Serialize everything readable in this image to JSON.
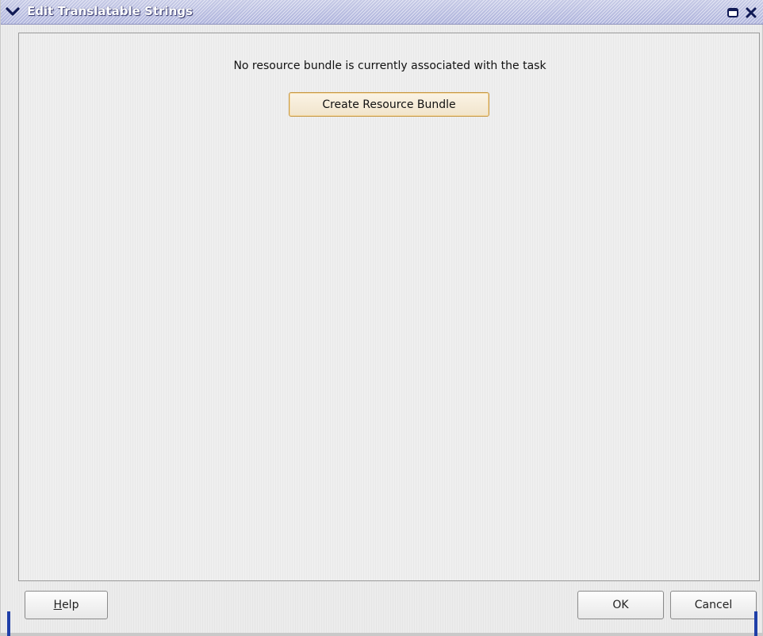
{
  "window": {
    "title": "Edit Translatable Strings",
    "controls": {
      "menu_icon": "chevron-down-icon",
      "maximize_icon": "maximize-icon",
      "close_icon": "close-icon"
    },
    "colors": {
      "titlebar": "#b7bce2",
      "accent_button_border": "#c69a4a"
    }
  },
  "main": {
    "message": "No resource bundle is currently associated with the task",
    "create_button_label": "Create Resource Bundle"
  },
  "footer": {
    "help": {
      "mnemonic": "H",
      "rest": "elp"
    },
    "ok_label": "OK",
    "cancel_label": "Cancel"
  }
}
